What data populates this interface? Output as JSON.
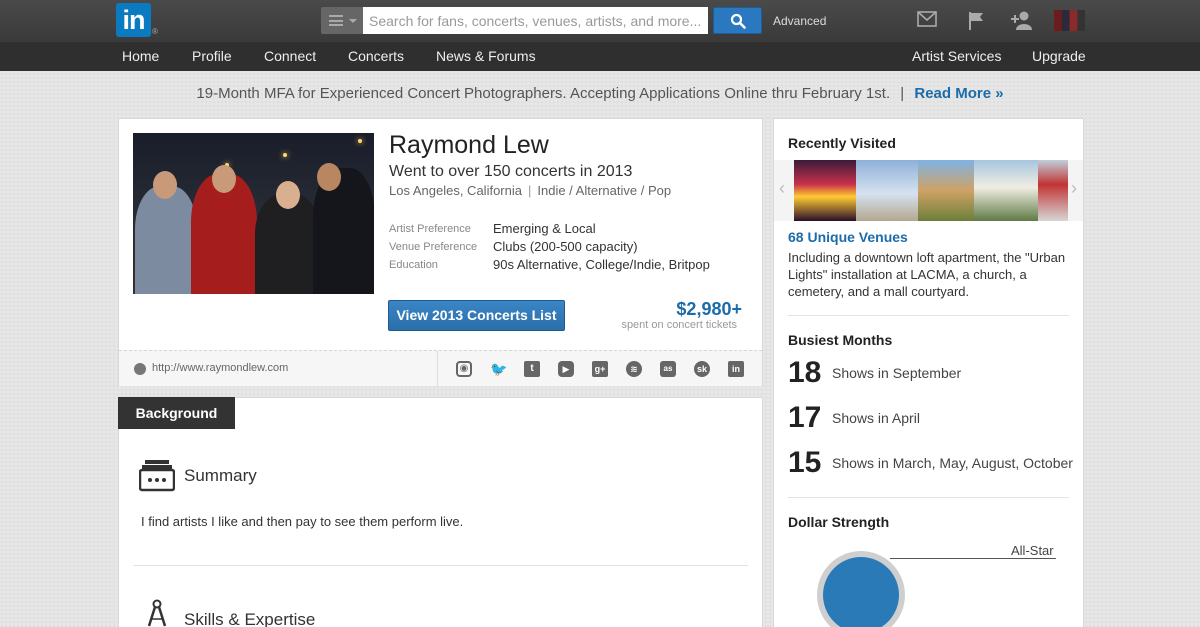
{
  "topbar": {
    "logo_text": "in",
    "logo_reg": "®",
    "search_placeholder": "Search for fans, concerts, venues, artists, and more...",
    "advanced_label": "Advanced",
    "icons": [
      "mail-icon",
      "flag-icon",
      "add-connection-icon",
      "profile-avatar"
    ]
  },
  "nav": {
    "home": "Home",
    "profile": "Profile",
    "connect": "Connect",
    "concerts": "Concerts",
    "news": "News & Forums",
    "artist_services": "Artist Services",
    "upgrade": "Upgrade"
  },
  "banner": {
    "text": "19-Month MFA for Experienced Concert Photographers. Accepting Applications Online thru February 1st.",
    "separator": "|",
    "link": "Read More »"
  },
  "profile": {
    "name": "Raymond Lew",
    "tagline": "Went to over 150 concerts in 2013",
    "location": "Los Angeles, California",
    "separator": "|",
    "genre": "Indie / Alternative / Pop",
    "details": [
      {
        "label": "Artist Preference",
        "value": "Emerging & Local"
      },
      {
        "label": "Venue Preference",
        "value": "Clubs (200-500 capacity)"
      },
      {
        "label": "Education",
        "value": "90s Alternative, College/Indie, Britpop"
      }
    ],
    "view_button": "View 2013 Concerts List",
    "spend_amount": "$2,980+",
    "spend_label": "spent on concert tickets",
    "website": "http://www.raymondlew.com",
    "social_icons": [
      "instagram-icon",
      "twitter-icon",
      "tumblr-icon",
      "youtube-icon",
      "google-plus-icon",
      "spotify-icon",
      "lastfm-icon",
      "songkick-icon",
      "linkedin-icon"
    ]
  },
  "background": {
    "tab": "Background",
    "summary_title": "Summary",
    "summary_text": "I find artists I like and then pay to see them perform live.",
    "skills_title": "Skills & Expertise"
  },
  "sidebar": {
    "recent_title": "Recently Visited",
    "venues_link": "68 Unique Venues",
    "venues_desc": "Including a downtown loft apartment, the \"Urban Lights\" installation at LACMA, a church, a cemetery, and a mall courtyard.",
    "busiest_title": "Busiest Months",
    "busiest": [
      {
        "num": "18",
        "text": "Shows in September"
      },
      {
        "num": "17",
        "text": "Shows in April"
      },
      {
        "num": "15",
        "text": "Shows in March, May, August, October"
      }
    ],
    "dollar_title": "Dollar Strength",
    "dollar_level_label": "All-Star"
  },
  "colors": {
    "accent": "#1a6cab",
    "button": "#2a6eaa",
    "topbar": "#3a3a3a",
    "navbar": "#2f2f2f",
    "gauge": "#2a7ab8"
  }
}
